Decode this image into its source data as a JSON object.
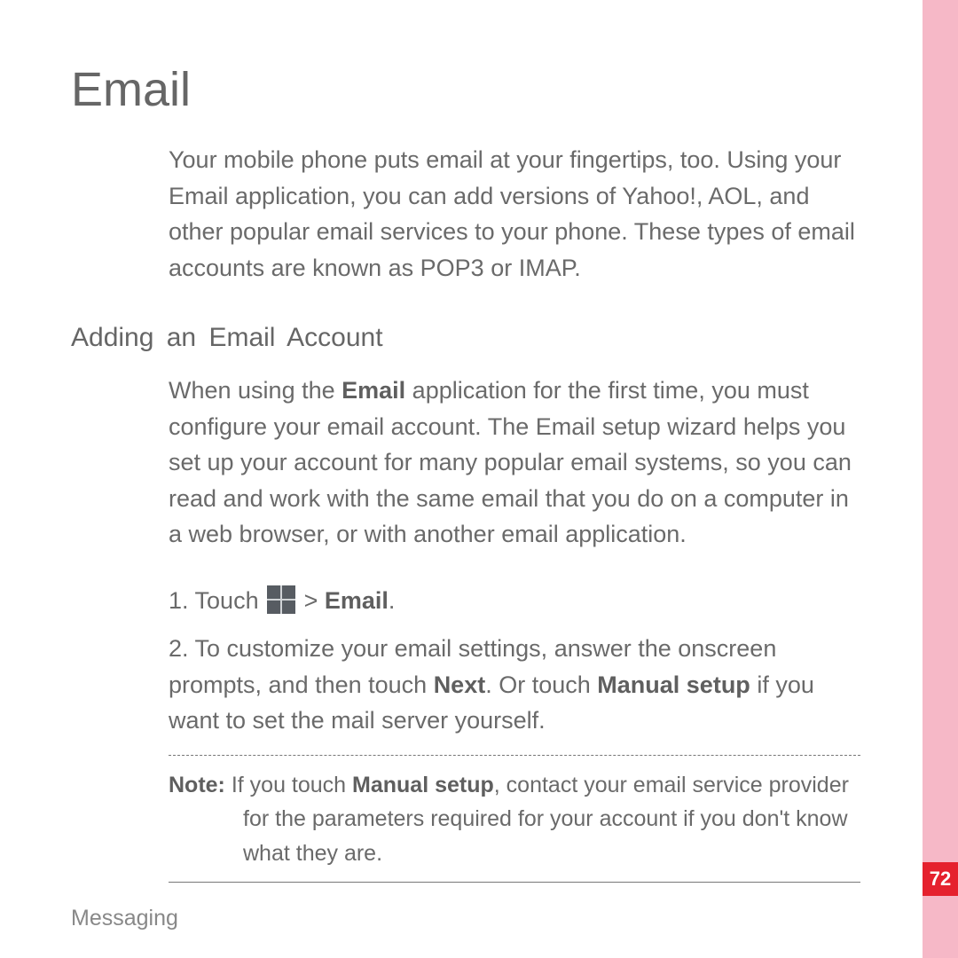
{
  "page": {
    "side_stripe_color": "#f6b8c7",
    "page_number_bg": "#e5212e",
    "page_number": "72",
    "footer": "Messaging"
  },
  "h1": "Email",
  "intro": "Your mobile phone puts email at your fingertips, too. Using your Email application, you can add versions of Yahoo!, AOL, and other popular email services to your phone. These types of email accounts are known as POP3 or IMAP.",
  "h2": "Adding  an  Email  Account",
  "section_intro_parts": {
    "p1": "When using the ",
    "b1": "Email",
    "p2": " application for the first time, you must configure your email account. The Email setup wizard helps you set up your account for many popular email systems, so you can read and work with the same email that you do on a computer in a web browser, or with another email application."
  },
  "steps": {
    "s1": {
      "num": "1. ",
      "pre": "Touch ",
      "icon_name": "apps-grid-icon",
      "mid": " > ",
      "bold": "Email",
      "post": "."
    },
    "s2": {
      "num": "2. ",
      "p1": "To customize your email settings, answer the onscreen prompts, and then touch ",
      "b1": "Next",
      "p2": ". Or touch ",
      "b2": "Manual setup",
      "p3": " if you want to set the mail server yourself."
    }
  },
  "note": {
    "label": "Note:  ",
    "p1": "If you touch ",
    "b1": "Manual setup",
    "p2": ", contact your email service provider for the parameters required for your account if you don't know what they are."
  }
}
